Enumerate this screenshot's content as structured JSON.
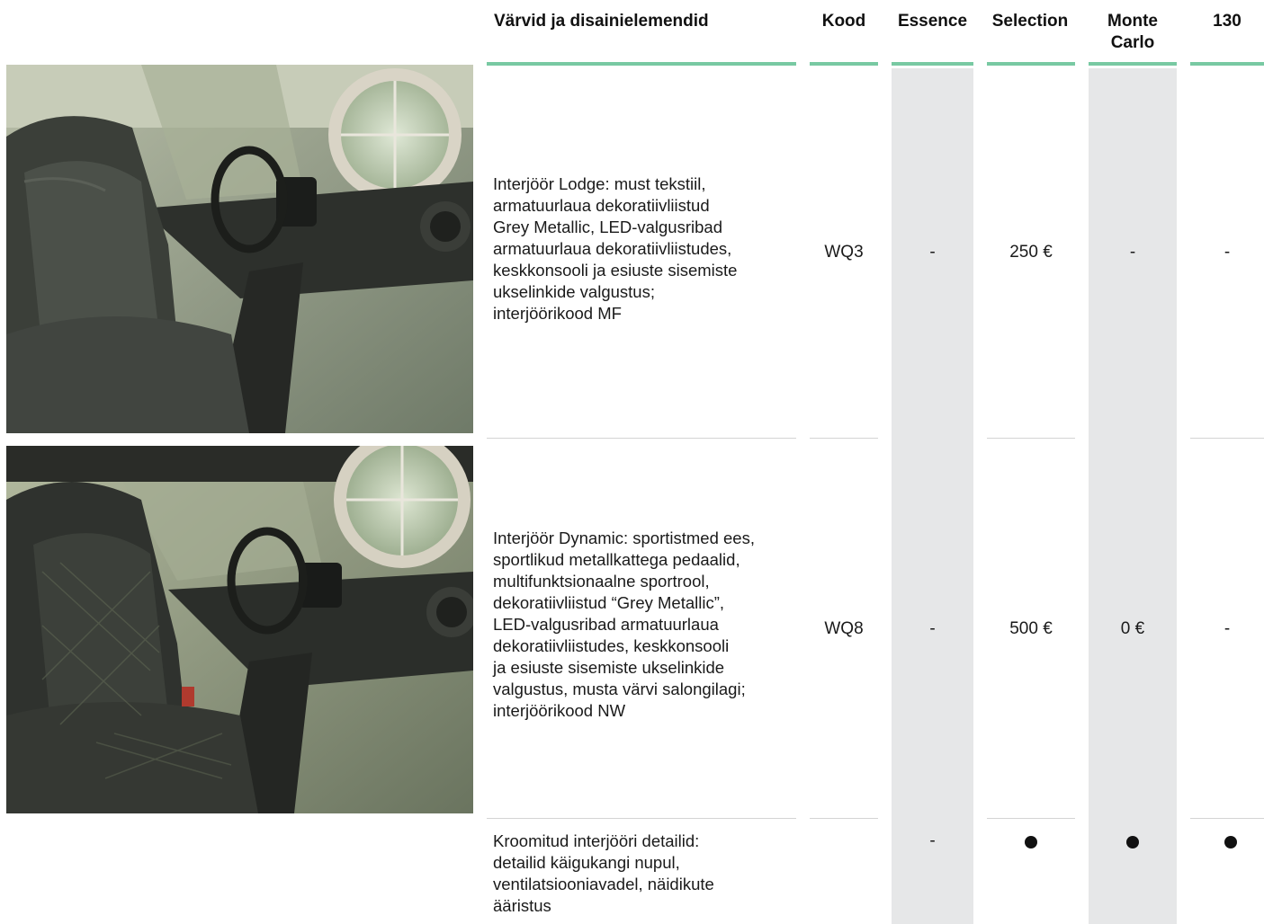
{
  "header": {
    "col_description": "Värvid ja disainielemendid",
    "col_code": "Kood",
    "col_essence": "Essence",
    "col_selection": "Selection",
    "col_monte_carlo": "Monte Carlo",
    "col_130": "130"
  },
  "colors": {
    "accent_line": "#78c9a2",
    "column_shade": "#e6e7e8",
    "row_separator": "#d4d4d4"
  },
  "rows": [
    {
      "description": "Interjöör Lodge: must tekstiil,\narmatuurlaua dekoratiivliistud\nGrey Metallic, LED-valgusribad\narmatuurlaua dekoratiivliistudes,\nkeskkonsooli ja  esiuste sisemiste\nukselinkide valgustus;\n interjöörikood MF",
      "code": "WQ3",
      "essence": "-",
      "selection": "250 €",
      "monte_carlo": "-",
      "v130": "-"
    },
    {
      "description": "Interjöör Dynamic: sportistmed ees,\nsportlikud metallkattega pedaalid,\nmultifunktsionaalne sportrool,\ndekoratiivliistud “Grey Metallic”,\nLED-valgusribad armatuurlaua\ndekoratiivliistudes, keskkonsooli\nja esiuste sisemiste ukselinkide\nvalgustus, musta värvi salongilagi;\ninterjöörikood NW",
      "code": "WQ8",
      "essence": "-",
      "selection": "500 €",
      "monte_carlo": "0 €",
      "v130": "-"
    },
    {
      "description": "Kroomitud interjööri detailid:\ndetailid käigukangi nupul,\nventilatsiooniavadel, näidikute\nääristus",
      "code": "",
      "essence": "-",
      "selection": "bullet",
      "monte_carlo": "bullet",
      "v130": "bullet"
    }
  ]
}
